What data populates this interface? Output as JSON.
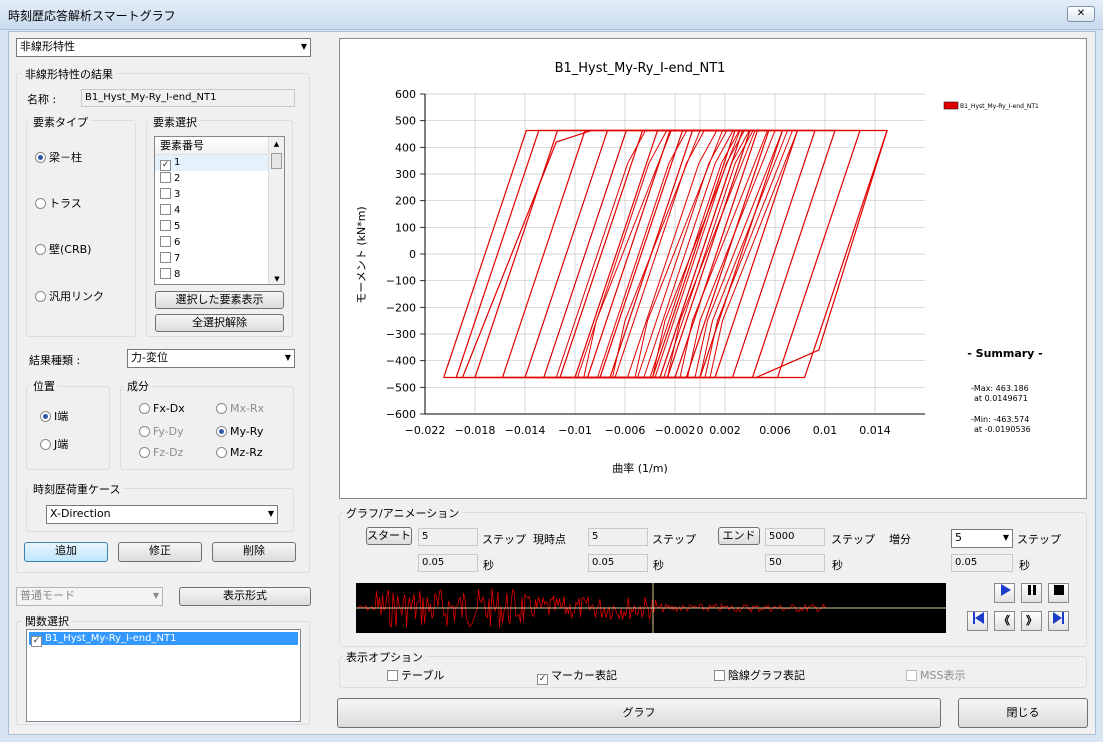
{
  "window": {
    "title": "時刻歴応答解析スマートグラフ",
    "close_icon": "✕"
  },
  "left": {
    "top_select": "非線形特性",
    "result_group": "非線形特性の結果",
    "name_label": "名称 :",
    "name_value": "B1_Hyst_My-Ry_I-end_NT1",
    "elem_type_group": "要素タイプ",
    "elem_types": [
      "梁－柱",
      "トラス",
      "壁(CRB)",
      "汎用リンク"
    ],
    "elem_select_group": "要素選択",
    "elem_list_header": "要素番号",
    "elem_numbers": [
      "1",
      "2",
      "3",
      "4",
      "5",
      "6",
      "7",
      "8"
    ],
    "show_selected_btn": "選択した要素表示",
    "deselect_all_btn": "全選択解除",
    "result_kind_label": "結果種類 :",
    "result_kind_value": "力-変位",
    "position_group": "位置",
    "positions": [
      "I端",
      "J端"
    ],
    "component_group": "成分",
    "components": [
      "Fx-Dx",
      "Mx-Rx",
      "Fy-Dy",
      "My-Ry",
      "Fz-Dz",
      "Mz-Rz"
    ],
    "loadcase_group": "時刻歴荷重ケース",
    "loadcase_value": "X-Direction",
    "add_btn": "追加",
    "modify_btn": "修正",
    "delete_btn": "削除",
    "mode_value": "普通モード",
    "format_btn": "表示形式",
    "func_select_label": "関数選択",
    "func_item": "B1_Hyst_My-Ry_I-end_NT1"
  },
  "chart_data": {
    "type": "line",
    "title": "B1_Hyst_My-Ry_I-end_NT1",
    "xlabel": "曲率 (1/m)",
    "ylabel": "モーメント (kN*m)",
    "xlim": [
      -0.022,
      0.018
    ],
    "ylim": [
      -600,
      600
    ],
    "xticks": [
      "−0.022",
      "−0.018",
      "−0.014",
      "−0.01",
      "−0.006",
      "−0.002",
      "0",
      "0.002",
      "0.006",
      "0.01",
      "0.014"
    ],
    "yticks": [
      "600",
      "500",
      "400",
      "300",
      "200",
      "100",
      "0",
      "−100",
      "−200",
      "−300",
      "−400",
      "−500",
      "−600"
    ],
    "legend": "B1_Hyst_My-Ry_I-end_NT1",
    "grid": true,
    "series_color": "#e00000",
    "summary": {
      "heading": "- Summary -",
      "max_label": "-Max: 463.186",
      "max_at": "at 0.0149671",
      "min_label": "-Min: -463.574",
      "min_at": "at -0.0190536"
    },
    "loops": [
      {
        "x0": -0.0205,
        "x1": -0.0115,
        "x2": 0.0149671,
        "x3": -0.0063
      },
      {
        "x0": -0.0195,
        "x1": -0.0098,
        "x2": 0.0128,
        "x3": -0.004
      },
      {
        "x0": -0.018,
        "x1": -0.0082,
        "x2": 0.0108,
        "x3": -0.0022
      },
      {
        "x0": -0.0158,
        "x1": -0.0068,
        "x2": 0.0092,
        "x3": -0.0008
      },
      {
        "x0": -0.014,
        "x1": -0.0058,
        "x2": 0.0078,
        "x3": 0.0004
      },
      {
        "x0": -0.0125,
        "x1": -0.005,
        "x2": 0.0066,
        "x3": 0.0014
      },
      {
        "x0": -0.0112,
        "x1": -0.0045,
        "x2": 0.0055,
        "x3": 0.002
      },
      {
        "x0": -0.01,
        "x1": -0.004,
        "x2": 0.0046,
        "x3": 0.0026
      },
      {
        "x0": -0.009,
        "x1": -0.0036,
        "x2": 0.004,
        "x3": 0.003
      },
      {
        "x0": -0.008,
        "x1": -0.0032,
        "x2": 0.0034,
        "x3": 0.0034
      },
      {
        "x0": -0.0072,
        "x1": -0.0029,
        "x2": 0.0028,
        "x3": 0.0038
      }
    ]
  },
  "anim": {
    "group": "グラフ/アニメーション",
    "start_btn": "スタート",
    "start_step": "5",
    "start_sec": "0.05",
    "step_unit": "ステップ",
    "sec_unit": "秒",
    "current_label": "現時点",
    "current_step": "5",
    "current_sec": "0.05",
    "end_btn": "エンド",
    "end_step": "5000",
    "end_sec": "50",
    "inc_label": "増分",
    "inc_value": "5",
    "inc_sec": "0.05"
  },
  "display": {
    "group": "表示オプション",
    "table": "テーブル",
    "marker": "マーカー表記",
    "hidden": "陰線グラフ表記",
    "mss": "MSS表示"
  },
  "bottom": {
    "graph_btn": "グラフ",
    "close_btn": "閉じる"
  }
}
